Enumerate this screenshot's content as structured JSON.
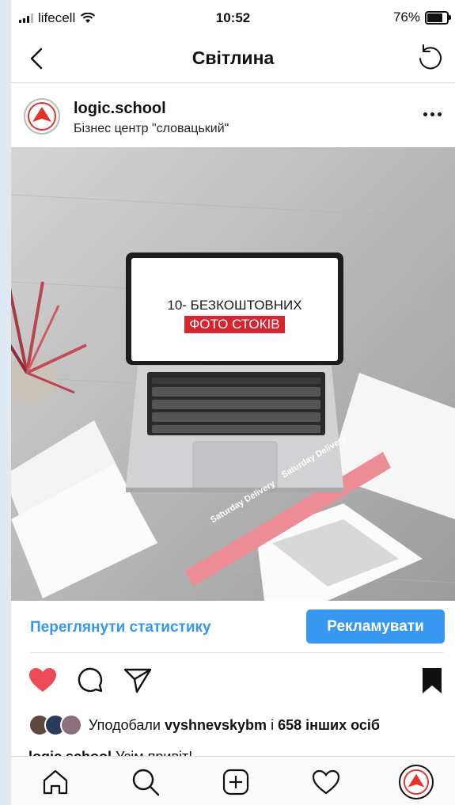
{
  "status_bar": {
    "carrier": "lifecell",
    "time": "10:52",
    "battery": "76%",
    "battery_level": 0.76
  },
  "header": {
    "title": "Світлина"
  },
  "post": {
    "username": "logic.school",
    "location": "Бізнес центр \"словацький\"",
    "image": {
      "screen_line1": "10- БЕЗКОШТОВНИХ",
      "screen_line2": "ФОТО СТОКІВ",
      "tape_text": "Saturday Delivery"
    }
  },
  "actions": {
    "stats_link": "Переглянути статистику",
    "promote_button": "Рекламувати"
  },
  "likes": {
    "prefix": "Уподобали",
    "user": "vyshnevskybm",
    "middle": "і",
    "others": "658 інших осіб"
  },
  "caption": {
    "username": "logic.school",
    "text": "Усім привіт!"
  },
  "colors": {
    "accent": "#3897f0",
    "like": "#ed4956",
    "brand_red": "#e5312a"
  }
}
